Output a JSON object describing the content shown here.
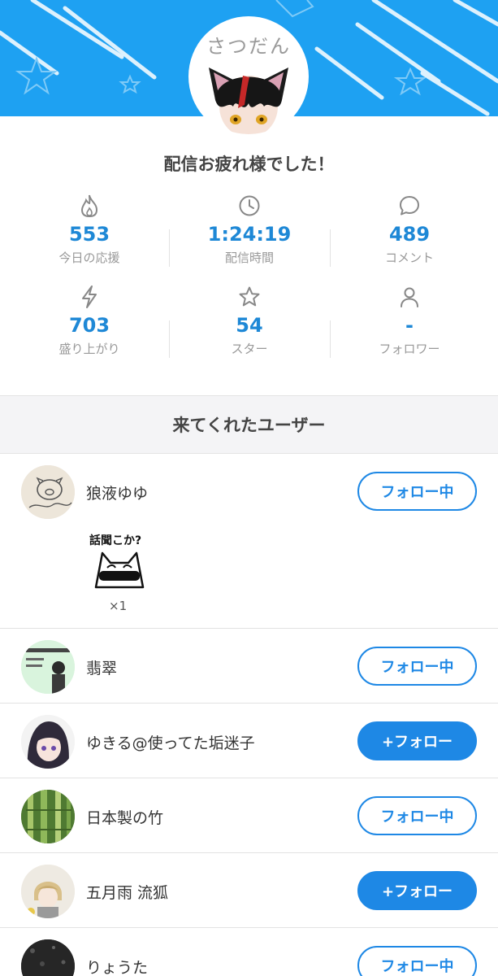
{
  "profile": {
    "caption": "さつだん",
    "avatar_icon": "cat-ear-boy-avatar"
  },
  "title": "配信お疲れ様でした！",
  "stats": [
    {
      "icon": "flame-icon",
      "value": "553",
      "label": "今日の応援"
    },
    {
      "icon": "clock-icon",
      "value": "1:24:19",
      "label": "配信時間"
    },
    {
      "icon": "comment-icon",
      "value": "489",
      "label": "コメント"
    },
    {
      "icon": "lightning-icon",
      "value": "703",
      "label": "盛り上がり"
    },
    {
      "icon": "star-icon",
      "value": "54",
      "label": "スター"
    },
    {
      "icon": "person-icon",
      "value": "-",
      "label": "フォロワー"
    }
  ],
  "section_title": "来てくれたユーザー",
  "gift": {
    "text": "話聞こか?",
    "count": "×1"
  },
  "users": [
    {
      "name": "狼液ゆゆ",
      "button": "フォロー中",
      "state": "following"
    },
    {
      "name": "翡翠",
      "button": "フォロー中",
      "state": "following"
    },
    {
      "name": "ゆきる@使ってた垢迷子",
      "button": "+フォロー",
      "state": "follow"
    },
    {
      "name": "日本製の竹",
      "button": "フォロー中",
      "state": "following"
    },
    {
      "name": "五月雨 流狐",
      "button": "+フォロー",
      "state": "follow"
    },
    {
      "name": "りょうた",
      "button": "フォロー中",
      "state": "following"
    }
  ],
  "colors": {
    "banner": "#1ea1f2",
    "accent": "#1e88e5",
    "stat_number": "#1e88d6"
  }
}
